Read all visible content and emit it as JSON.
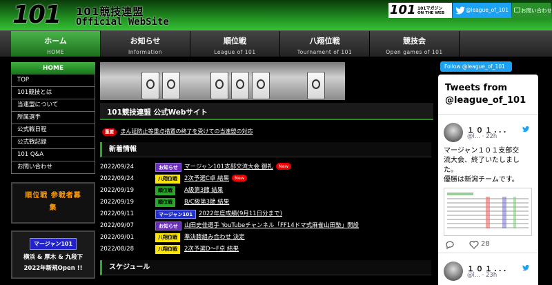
{
  "header": {
    "logo_num": "101",
    "logo_title": "101競技連盟",
    "logo_subtitle": "Official WebSite",
    "magazine_num": "101",
    "magazine_line1": "101マガジン",
    "magazine_line2": "ON THE WEB",
    "twitter_handle": "@league_of_101",
    "contact_label": "お問い合わせ"
  },
  "nav": [
    {
      "jp": "ホーム",
      "en": "HOME",
      "active": true
    },
    {
      "jp": "お知らせ",
      "en": "Information"
    },
    {
      "jp": "順位戦",
      "en": "League of 101"
    },
    {
      "jp": "八翔位戦",
      "en": "Tournament of 101"
    },
    {
      "jp": "競技会",
      "en": "Open games of 101"
    }
  ],
  "sidebar": {
    "head": "HOME",
    "items": [
      "TOP",
      "101競技とは",
      "当連盟について",
      "所属選手",
      "公式戦日程",
      "公式戦記録",
      "101 Q&A",
      "お問い合わせ"
    ],
    "banner1_line1": "順位戦 参戦者募",
    "banner1_line2": "集",
    "banner2_badge": "マージャン101",
    "banner2_line1": "横浜 & 厚木 & 九段下",
    "banner2_line2": "2022年新規Open !!"
  },
  "main": {
    "title": "101競技連盟 公式Webサイト",
    "notice_badge": "重要",
    "notice_text": "まん延防止等重点措置の終了を受けての当連盟の対応",
    "news_heading": "新着情報",
    "schedule_heading": "スケジュール",
    "news": [
      {
        "date": "2022/09/24",
        "badge": "お知らせ",
        "type": "notice",
        "text": "マージャン101支部交流大会 御礼",
        "new": "New"
      },
      {
        "date": "2022/09/24",
        "badge": "八翔位戦",
        "type": "hassho",
        "text": "2次予選C卓 結果",
        "new": "New"
      },
      {
        "date": "2022/09/19",
        "badge": "順位戦",
        "type": "juni",
        "text": "A級第3節 結果"
      },
      {
        "date": "2022/09/19",
        "badge": "順位戦",
        "type": "juni",
        "text": "B/C級第3節 結果"
      },
      {
        "date": "2022/09/11",
        "badge": "マージャン101",
        "type": "mj",
        "text": "2022年度成績(9月11日分まで)"
      },
      {
        "date": "2022/09/07",
        "badge": "お知らせ",
        "type": "notice",
        "text": "山田史佳選手 YouTubeチャンネル「FF14ドマ式麻雀山田塾」開設"
      },
      {
        "date": "2022/09/01",
        "badge": "八翔位戦",
        "type": "hassho",
        "text": "準決勝組み合わせ 決定"
      },
      {
        "date": "2022/08/28",
        "badge": "八翔位戦",
        "type": "hassho",
        "text": "2次予選D〜F卓 結果"
      }
    ]
  },
  "twitter": {
    "follow_label": "Follow @league_of_101",
    "widget_title": "Tweets from @league_of_101",
    "tweet1": {
      "name": "１０１...",
      "meta": "@l... · 22h",
      "text_lines": [
        "マージャン１０１支部交",
        "流大会、終了いたしまし",
        "た。",
        "優勝は新潟チームです。"
      ],
      "replies": "",
      "likes": "28"
    },
    "tweet2": {
      "name": "１０１...",
      "meta": "@l... · 23h"
    }
  },
  "colors": {
    "accent_green": "#2aaa2a",
    "twitter_blue": "#1da1f2",
    "important_red": "#cc0000"
  }
}
